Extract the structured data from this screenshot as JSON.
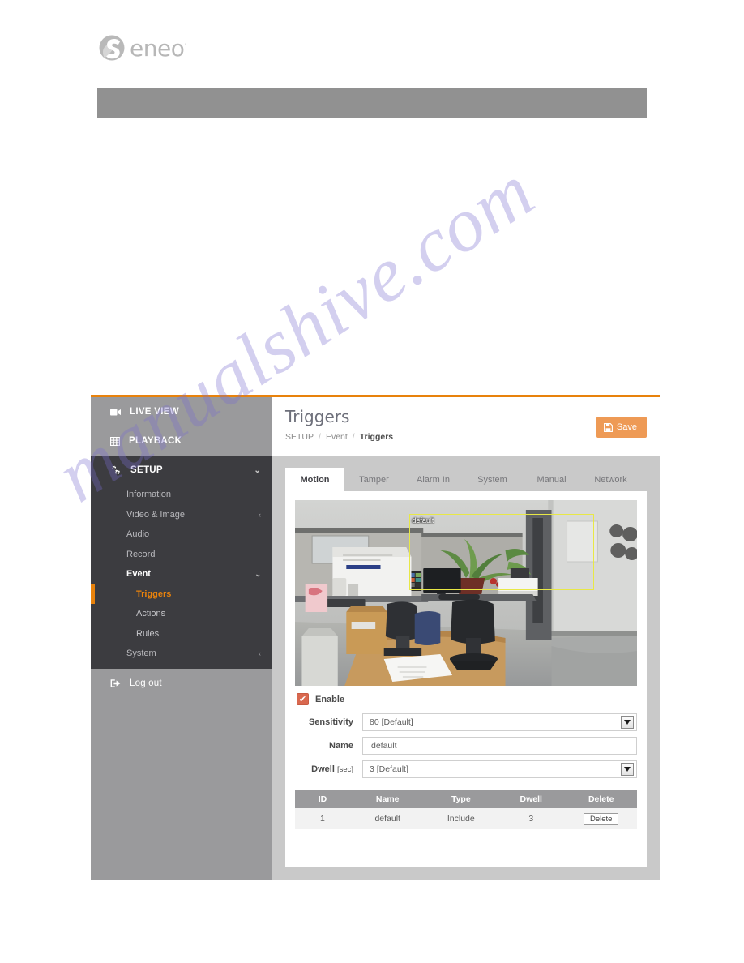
{
  "brand": {
    "name": "eneo",
    "superscript": "·"
  },
  "watermark": {
    "text": "manualshive.com"
  },
  "app": {
    "sidebar": {
      "top_items": [
        {
          "label": "LIVE VIEW",
          "icon": "video-camera-icon"
        },
        {
          "label": "PLAYBACK",
          "icon": "film-strip-icon"
        }
      ],
      "setup": {
        "label": "SETUP",
        "icon": "gears-icon",
        "caret": "⌄"
      },
      "items": [
        {
          "label": "Information",
          "expandable": false
        },
        {
          "label": "Video & Image",
          "expandable": true,
          "caret": "‹"
        },
        {
          "label": "Audio",
          "expandable": false
        },
        {
          "label": "Record",
          "expandable": false
        },
        {
          "label": "Event",
          "expandable": true,
          "caret": "⌄"
        }
      ],
      "event_children": [
        {
          "label": "Triggers",
          "active": true
        },
        {
          "label": "Actions",
          "active": false
        },
        {
          "label": "Rules",
          "active": false
        }
      ],
      "system": {
        "label": "System",
        "caret": "‹"
      },
      "logout": {
        "label": "Log out",
        "icon": "logout-icon"
      }
    },
    "header": {
      "title": "Triggers",
      "breadcrumb": [
        "SETUP",
        "Event",
        "Triggers"
      ],
      "separator": "/",
      "save_label": "Save"
    },
    "tabs": [
      {
        "label": "Motion",
        "active": true
      },
      {
        "label": "Tamper",
        "active": false
      },
      {
        "label": "Alarm In",
        "active": false
      },
      {
        "label": "System",
        "active": false
      },
      {
        "label": "Manual",
        "active": false
      },
      {
        "label": "Network",
        "active": false
      }
    ],
    "preview": {
      "roi_label": "default"
    },
    "form": {
      "enable_label": "Enable",
      "enable_checked": true,
      "check_glyph": "✔",
      "sensitivity_label": "Sensitivity",
      "sensitivity_value": "80 [Default]",
      "name_label": "Name",
      "name_value": "default",
      "dwell_label": "Dwell",
      "dwell_unit": "[sec]",
      "dwell_value": "3 [Default]"
    },
    "table": {
      "headers": [
        "ID",
        "Name",
        "Type",
        "Dwell",
        "Delete"
      ],
      "rows": [
        {
          "id": "1",
          "name": "default",
          "type": "Include",
          "dwell": "3",
          "delete_label": "Delete"
        }
      ]
    },
    "colors": {
      "accent_orange": "#e8820c",
      "save_orange": "#ee9a55",
      "checkbox_red": "#d9684f",
      "sidebar_dark": "#3c3c40",
      "sidebar_light": "#9a9a9c",
      "roi_yellow": "#e8e846"
    }
  }
}
